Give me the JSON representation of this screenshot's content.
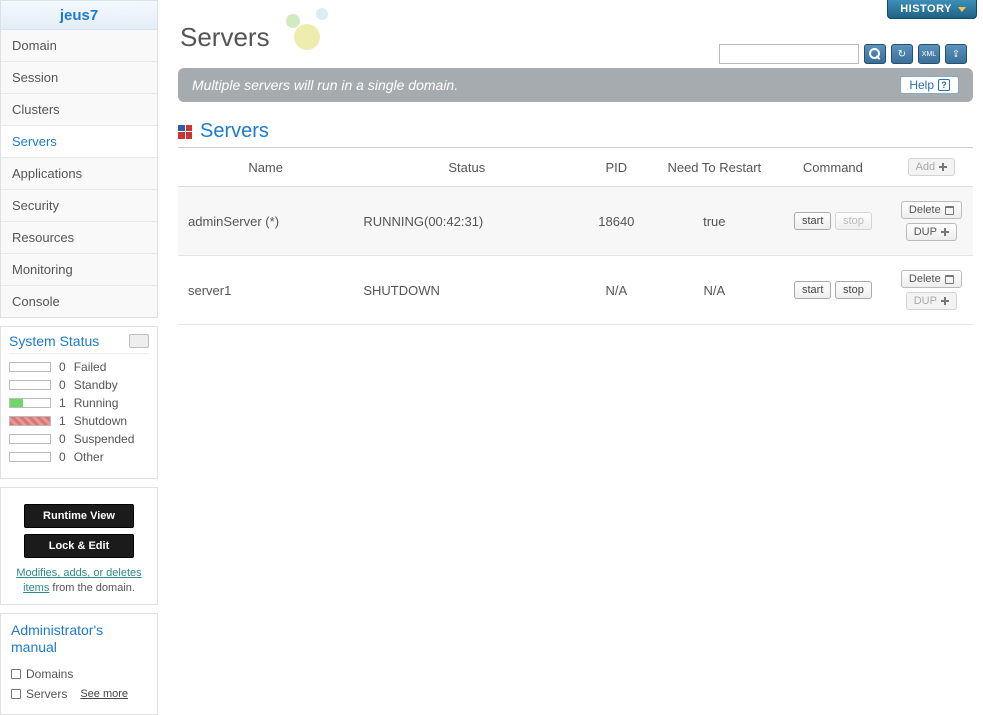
{
  "brand": "jeus7",
  "nav": {
    "items": [
      {
        "label": "Domain"
      },
      {
        "label": "Session"
      },
      {
        "label": "Clusters"
      },
      {
        "label": "Servers"
      },
      {
        "label": "Applications"
      },
      {
        "label": "Security"
      },
      {
        "label": "Resources"
      },
      {
        "label": "Monitoring"
      },
      {
        "label": "Console"
      }
    ],
    "active_index": 3
  },
  "system_status": {
    "title": "System Status",
    "rows": [
      {
        "count": "0",
        "label": "Failed",
        "style": "plain"
      },
      {
        "count": "0",
        "label": "Standby",
        "style": "plain"
      },
      {
        "count": "1",
        "label": "Running",
        "style": "green"
      },
      {
        "count": "1",
        "label": "Shutdown",
        "style": "red"
      },
      {
        "count": "0",
        "label": "Suspended",
        "style": "plain"
      },
      {
        "count": "0",
        "label": "Other",
        "style": "plain"
      }
    ]
  },
  "side_actions": {
    "runtime_view": "Runtime View",
    "lock_edit": "Lock & Edit",
    "link_text": "Modifies, adds, or deletes items",
    "tail_text": " from the domain."
  },
  "manual": {
    "title": "Administrator's manual",
    "items": [
      "Domains",
      "Servers"
    ],
    "see_more": "See more"
  },
  "header": {
    "history": "HISTORY",
    "page_title": "Servers",
    "desc": "Multiple servers will run in a single domain.",
    "help": "Help",
    "search_placeholder": ""
  },
  "toolbar_icons": {
    "refresh": "↻",
    "xml": "XML",
    "export": "⇪"
  },
  "servers": {
    "section_title": "Servers",
    "columns": {
      "name": "Name",
      "status": "Status",
      "pid": "PID",
      "restart": "Need To Restart",
      "command": "Command"
    },
    "add_label": "Add",
    "delete_label": "Delete",
    "dup_label": "DUP",
    "start_label": "start",
    "stop_label": "stop",
    "rows": [
      {
        "name": "adminServer (*)",
        "status": "RUNNING(00:42:31)",
        "pid": "18640",
        "restart": "true",
        "start_enabled": true,
        "stop_enabled": false,
        "dup_enabled": true
      },
      {
        "name": "server1",
        "status": "SHUTDOWN",
        "pid": "N/A",
        "restart": "N/A",
        "start_enabled": true,
        "stop_enabled": true,
        "dup_enabled": false
      }
    ]
  }
}
